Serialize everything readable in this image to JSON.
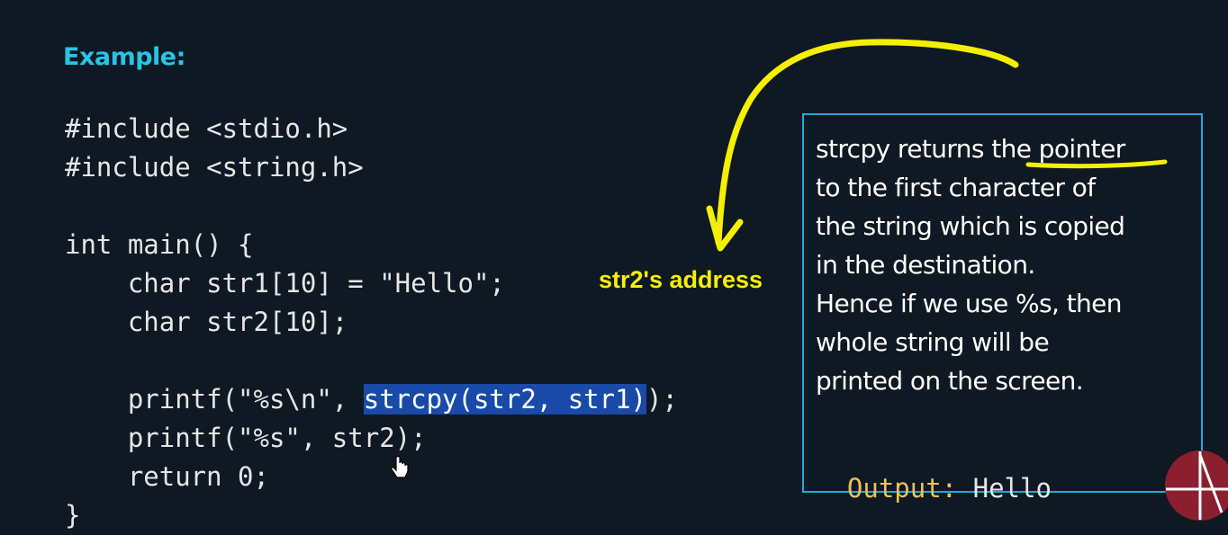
{
  "heading": "Example:",
  "code_lines": [
    {
      "pre": "#include <stdio.h>",
      "hl": "",
      "post": ""
    },
    {
      "pre": "#include <string.h>",
      "hl": "",
      "post": ""
    },
    {
      "pre": "",
      "hl": "",
      "post": ""
    },
    {
      "pre": "int main() {",
      "hl": "",
      "post": ""
    },
    {
      "pre": "    char str1[10] = \"Hello\";",
      "hl": "",
      "post": ""
    },
    {
      "pre": "    char str2[10];",
      "hl": "",
      "post": ""
    },
    {
      "pre": "",
      "hl": "",
      "post": ""
    },
    {
      "pre": "    printf(\"%s\\n\", ",
      "hl": "strcpy(str2, str1)",
      "post": ");"
    },
    {
      "pre": "    printf(\"%s\", str2);",
      "hl": "",
      "post": ""
    },
    {
      "pre": "    return 0;",
      "hl": "",
      "post": ""
    },
    {
      "pre": "}",
      "hl": "",
      "post": ""
    }
  ],
  "annotation": "str2's address",
  "note_lines": [
    "strcpy returns the pointer",
    "to the first character of",
    "the string which is copied",
    "in the destination.",
    "Hence if we use %s,  then",
    "whole string will be",
    "printed on the screen."
  ],
  "output": {
    "label": "Output:",
    "value": "Hello"
  },
  "colors": {
    "background": "#0f1923",
    "heading": "#28c4e6",
    "highlight": "#1a4aa8",
    "annotation": "#f5f000",
    "box_border": "#22a9d8",
    "output_label": "#e8c25a"
  }
}
